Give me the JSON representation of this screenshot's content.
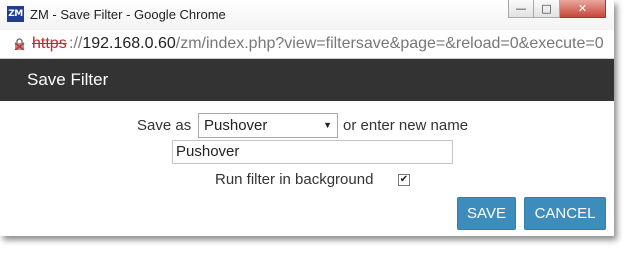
{
  "window": {
    "app_icon": "ZM",
    "title": "ZM - Save Filter - Google Chrome",
    "controls": {
      "minimize": "—",
      "maximize": "□",
      "close": "✕"
    }
  },
  "address_bar": {
    "scheme": "https",
    "rest_prefix": "://",
    "host": "192.168.0.60",
    "path": "/zm/index.php?view=filtersave&page=&reload=0&execute=0"
  },
  "dialog": {
    "title": "Save Filter",
    "save_as_label": "Save as",
    "select_value": "Pushover",
    "or_label": "or enter new name",
    "name_value": "Pushover",
    "background_label": "Run filter in background",
    "background_checked": true,
    "save_button": "SAVE",
    "cancel_button": "CANCEL"
  }
}
